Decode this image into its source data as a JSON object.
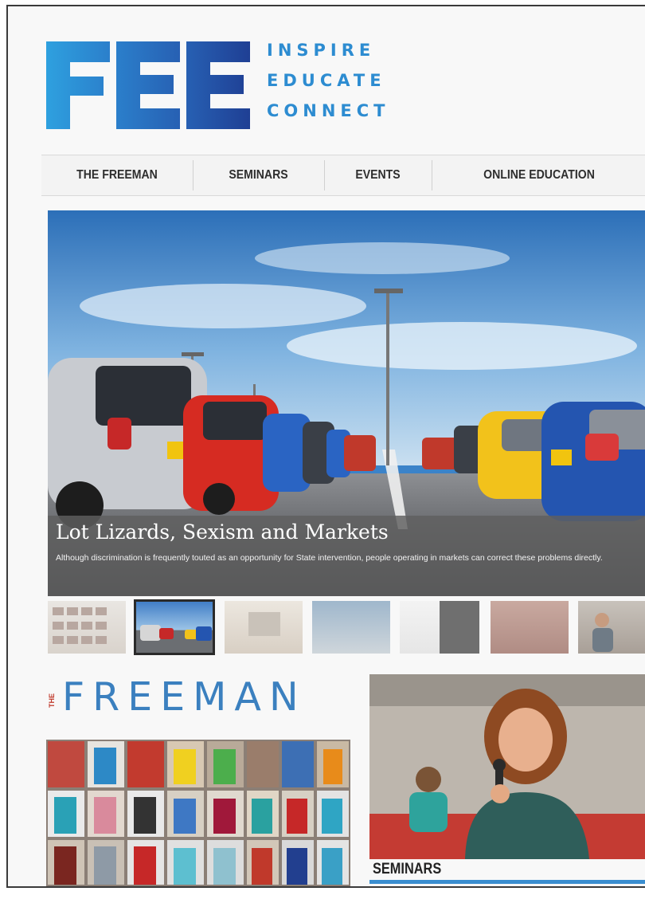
{
  "logo": {
    "letters": "FEE",
    "tagline": [
      "INSPIRE",
      "EDUCATE",
      "CONNECT"
    ],
    "colors": {
      "light_blue": "#2d8cd1",
      "dark_blue": "#1f4fa0"
    }
  },
  "nav": {
    "items": [
      "THE FREEMAN",
      "SEMINARS",
      "EVENTS",
      "ONLINE EDUCATION"
    ]
  },
  "hero": {
    "title": "Lot Lizards, Sexism and Markets",
    "description": "Although discrimination is frequently touted as an opportunity for State intervention, people operating in markets can correct these problems directly."
  },
  "thumbnails": {
    "count": 8,
    "active_index": 1,
    "labels": [
      "thumbnail-1",
      "thumbnail-2",
      "thumbnail-3",
      "thumbnail-4",
      "thumbnail-5",
      "thumbnail-6",
      "thumbnail-7",
      "thumbnail-8"
    ]
  },
  "freeman": {
    "prefix": "THE",
    "title": "FREEMAN"
  },
  "seminars": {
    "label": "SEMINARS"
  }
}
